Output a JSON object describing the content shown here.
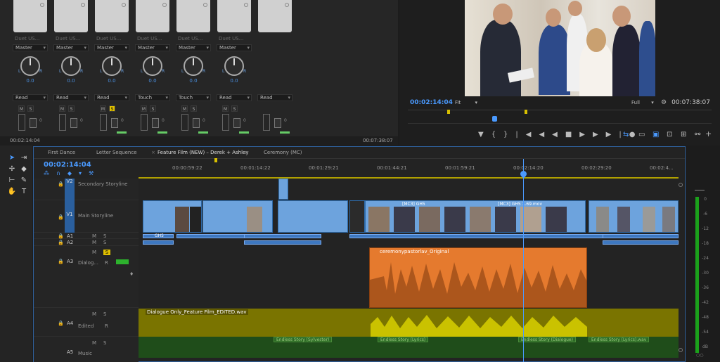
{
  "mixer": {
    "strips": [
      {
        "clip": "Duet US...",
        "dd1": "Master",
        "value": "0.0",
        "dd2": "Read"
      },
      {
        "clip": "Duet US...",
        "dd1": "Master",
        "value": "0.0",
        "dd2": "Read"
      },
      {
        "clip": "Duet US...",
        "dd1": "Master",
        "value": "0.0",
        "dd2": "Read"
      },
      {
        "clip": "Duet US...",
        "dd1": "Master",
        "value": "0.0",
        "dd2": "Touch"
      },
      {
        "clip": "Duet US...",
        "dd1": "Master",
        "value": "0.0",
        "dd2": "Touch"
      },
      {
        "clip": "Duet US...",
        "dd1": "Master",
        "value": "0.0",
        "dd2": "Read"
      },
      {
        "clip": "",
        "dd1": "",
        "value": "",
        "dd2": "Read"
      }
    ],
    "timecode_left": "00:02:14:04",
    "timecode_right": "00:07:38:07"
  },
  "monitor": {
    "timecode": "00:02:14:04",
    "fit": "Fit",
    "quality": "Full",
    "duration": "00:07:38:07",
    "controls": "▼{}|◀◀◀■▶▶▶|●"
  },
  "timeline": {
    "tabs": [
      "First Dance",
      "Letter Sequence",
      "Feature Film (NEW) – Derek + Ashley",
      "Ceremony (MC)"
    ],
    "timecode": "00:02:14:04",
    "ticks": [
      "00:00:59:22",
      "00:01:14:22",
      "00:01:29:21",
      "00:01:44:21",
      "00:01:59:21",
      "00:02:14:20",
      "00:02:29:20",
      "00:02:4..."
    ],
    "tracks": {
      "v2": {
        "id": "V2",
        "name": "Secondary Storyline"
      },
      "v1": {
        "id": "V1",
        "name": "Main Storyline"
      },
      "a1": "A1",
      "a2": "A2",
      "a3": {
        "id": "A3",
        "name": "Dialog..."
      },
      "a4": {
        "id": "A4",
        "name": "Edited"
      },
      "a5": {
        "id": "A5",
        "name": "Music"
      }
    },
    "clips": {
      "v1_labels": [
        "[MC3] GH5",
        "[MC3] GH5 1.69.mov"
      ],
      "a1_label": "GH5",
      "a3_clip": "ceremonypastorlav_Original",
      "a4_clip": "Dialogue Only_Feature Film_EDITED.wav",
      "music_clips": [
        "Endless Story (Sylvester)",
        "Endless Story (Lyrics)",
        "Endless Story (Dialogue)",
        "Endless Story (Lyrics).wav"
      ]
    },
    "track_buttons": {
      "m": "M",
      "s": "S",
      "r": "R"
    }
  },
  "meters": {
    "scale": [
      "0",
      "-6",
      "-12",
      "-18",
      "-24",
      "-30",
      "-36",
      "-42",
      "-48",
      "-54",
      "dB"
    ]
  }
}
